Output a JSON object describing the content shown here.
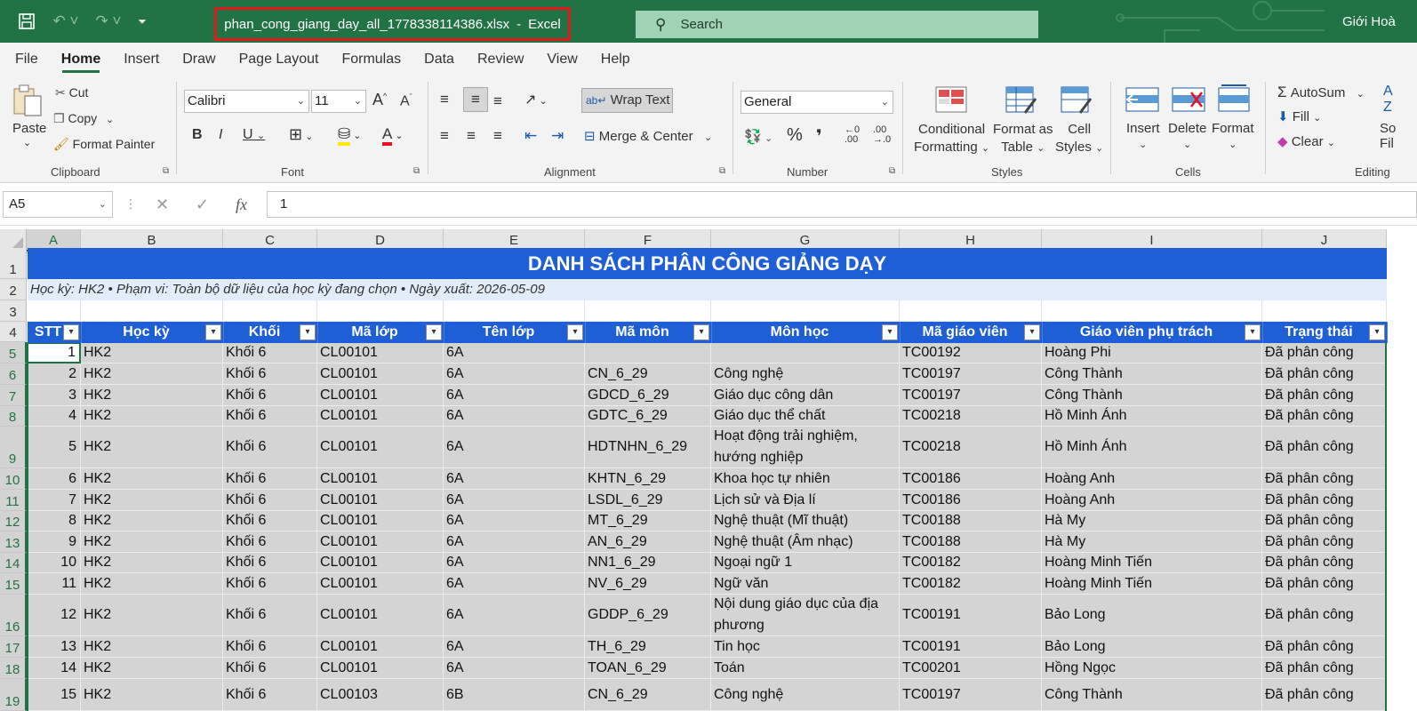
{
  "title_bar": {
    "filename": "phan_cong_giang_day_all_1778338114386.xlsx",
    "app": "Excel",
    "search_placeholder": "Search",
    "user": "Giới Hoà"
  },
  "menu": {
    "tabs": [
      "File",
      "Home",
      "Insert",
      "Draw",
      "Page Layout",
      "Formulas",
      "Data",
      "Review",
      "View",
      "Help"
    ],
    "active": "Home"
  },
  "ribbon": {
    "clipboard": {
      "paste": "Paste",
      "cut": "Cut",
      "copy": "Copy",
      "format_painter": "Format Painter",
      "label": "Clipboard"
    },
    "font": {
      "name": "Calibri",
      "size": "11",
      "label": "Font"
    },
    "alignment": {
      "wrap_text": "Wrap Text",
      "merge_center": "Merge & Center",
      "label": "Alignment"
    },
    "number": {
      "format": "General",
      "label": "Number"
    },
    "styles": {
      "conditional": "Conditional",
      "conditional2": "Formatting",
      "format_as": "Format as",
      "format_as2": "Table",
      "cell_styles": "Cell",
      "cell_styles2": "Styles",
      "label": "Styles"
    },
    "cells": {
      "insert": "Insert",
      "delete": "Delete",
      "format": "Format",
      "label": "Cells"
    },
    "editing": {
      "autosum": "AutoSum",
      "fill": "Fill",
      "clear": "Clear",
      "label": "Editing",
      "sort_partial": "So",
      "filter_partial": "Fil"
    }
  },
  "formula_bar": {
    "name_box": "A5",
    "formula": "1"
  },
  "columns": [
    "A",
    "B",
    "C",
    "D",
    "E",
    "F",
    "G",
    "H",
    "I",
    "J"
  ],
  "sheet": {
    "title": "DANH SÁCH PHÂN CÔNG GIẢNG DẠY",
    "subtitle": "Học kỳ: HK2 • Phạm vi: Toàn bộ dữ liệu của học kỳ đang chọn • Ngày xuất: 2026-05-09",
    "headers": [
      "STT",
      "Học kỳ",
      "Khối",
      "Mã lớp",
      "Tên lớp",
      "Mã môn",
      "Môn học",
      "Mã giáo viên",
      "Giáo viên phụ trách",
      "Trạng thái"
    ],
    "rows": [
      [
        "1",
        "HK2",
        "Khối 6",
        "CL00101",
        "6A",
        "",
        "",
        "TC00192",
        "Hoàng Phi",
        "Đã phân công"
      ],
      [
        "2",
        "HK2",
        "Khối 6",
        "CL00101",
        "6A",
        "CN_6_29",
        "Công nghệ",
        "TC00197",
        "Công Thành",
        "Đã phân công"
      ],
      [
        "3",
        "HK2",
        "Khối 6",
        "CL00101",
        "6A",
        "GDCD_6_29",
        "Giáo dục công dân",
        "TC00197",
        "Công Thành",
        "Đã phân công"
      ],
      [
        "4",
        "HK2",
        "Khối 6",
        "CL00101",
        "6A",
        "GDTC_6_29",
        "Giáo dục thể chất",
        "TC00218",
        "Hồ Minh Ánh",
        "Đã phân công"
      ],
      [
        "5",
        "HK2",
        "Khối 6",
        "CL00101",
        "6A",
        "HDTNHN_6_29",
        "Hoạt động trải nghiệm, hướng nghiệp",
        "TC00218",
        "Hồ Minh Ánh",
        "Đã phân công"
      ],
      [
        "6",
        "HK2",
        "Khối 6",
        "CL00101",
        "6A",
        "KHTN_6_29",
        "Khoa học tự nhiên",
        "TC00186",
        "Hoàng Anh",
        "Đã phân công"
      ],
      [
        "7",
        "HK2",
        "Khối 6",
        "CL00101",
        "6A",
        "LSDL_6_29",
        "Lịch sử và Địa lí",
        "TC00186",
        "Hoàng Anh",
        "Đã phân công"
      ],
      [
        "8",
        "HK2",
        "Khối 6",
        "CL00101",
        "6A",
        "MT_6_29",
        "Nghệ thuật (Mĩ thuật)",
        "TC00188",
        "Hà My",
        "Đã phân công"
      ],
      [
        "9",
        "HK2",
        "Khối 6",
        "CL00101",
        "6A",
        "AN_6_29",
        "Nghệ thuật (Âm nhạc)",
        "TC00188",
        "Hà My",
        "Đã phân công"
      ],
      [
        "10",
        "HK2",
        "Khối 6",
        "CL00101",
        "6A",
        "NN1_6_29",
        "Ngoại ngữ 1",
        "TC00182",
        "Hoàng Minh Tiến",
        "Đã phân công"
      ],
      [
        "11",
        "HK2",
        "Khối 6",
        "CL00101",
        "6A",
        "NV_6_29",
        "Ngữ văn",
        "TC00182",
        "Hoàng Minh Tiến",
        "Đã phân công"
      ],
      [
        "12",
        "HK2",
        "Khối 6",
        "CL00101",
        "6A",
        "GDDP_6_29",
        "Nội dung giáo dục của địa phương",
        "TC00191",
        "Bảo Long",
        "Đã phân công"
      ],
      [
        "13",
        "HK2",
        "Khối 6",
        "CL00101",
        "6A",
        "TH_6_29",
        "Tin học",
        "TC00191",
        "Bảo Long",
        "Đã phân công"
      ],
      [
        "14",
        "HK2",
        "Khối 6",
        "CL00101",
        "6A",
        "TOAN_6_29",
        "Toán",
        "TC00201",
        "Hồng Ngọc",
        "Đã phân công"
      ],
      [
        "15",
        "HK2",
        "Khối 6",
        "CL00103",
        "6B",
        "CN_6_29",
        "Công nghệ",
        "TC00197",
        "Công Thành",
        "Đã phân công"
      ]
    ],
    "row_numbers": [
      "1",
      "2",
      "3",
      "4",
      "5",
      "6",
      "7",
      "8",
      "9",
      "10",
      "11",
      "12",
      "13",
      "14",
      "15",
      "16",
      "17",
      "18",
      "19"
    ]
  }
}
